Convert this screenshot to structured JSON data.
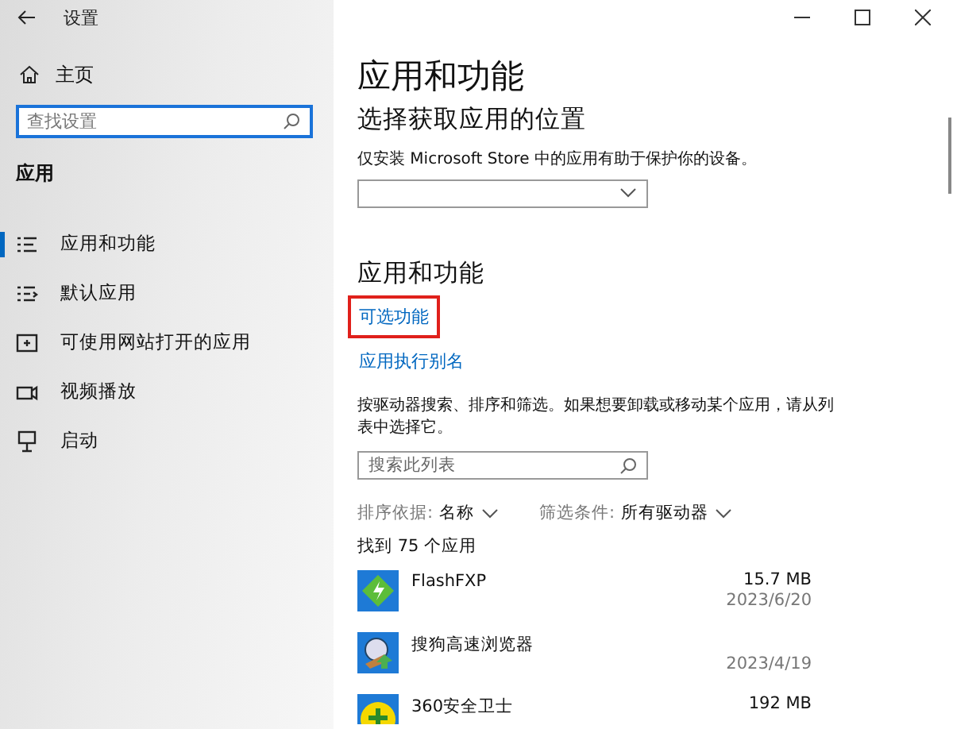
{
  "window": {
    "title": "设置"
  },
  "sidebar": {
    "home": "主页",
    "search": {
      "placeholder": "查找设置"
    },
    "section": "应用",
    "items": [
      {
        "label": "应用和功能",
        "selected": true
      },
      {
        "label": "默认应用",
        "selected": false
      },
      {
        "label": "可使用网站打开的应用",
        "selected": false
      },
      {
        "label": "视频播放",
        "selected": false
      },
      {
        "label": "启动",
        "selected": false
      }
    ]
  },
  "main": {
    "title": "应用和功能",
    "source": {
      "heading": "选择获取应用的位置",
      "description": "仅安装 Microsoft Store 中的应用有助于保护你的设备。"
    },
    "section": "应用和功能",
    "links": [
      {
        "label": "可选功能",
        "highlighted": true
      },
      {
        "label": "应用执行别名",
        "highlighted": false
      }
    ],
    "description": "按驱动器搜索、排序和筛选。如果想要卸载或移动某个应用，请从列表中选择它。",
    "search": {
      "placeholder": "搜索此列表"
    },
    "sort": {
      "label": "排序依据:",
      "value": "名称"
    },
    "filter": {
      "label": "筛选条件:",
      "value": "所有驱动器"
    },
    "count": "找到 75 个应用",
    "apps": [
      {
        "name": "FlashFXP",
        "size": "15.7 MB",
        "date": "2023/6/20"
      },
      {
        "name": "搜狗高速浏览器",
        "date": "2023/4/19"
      },
      {
        "name": "360安全卫士",
        "size": "192 MB"
      }
    ]
  }
}
